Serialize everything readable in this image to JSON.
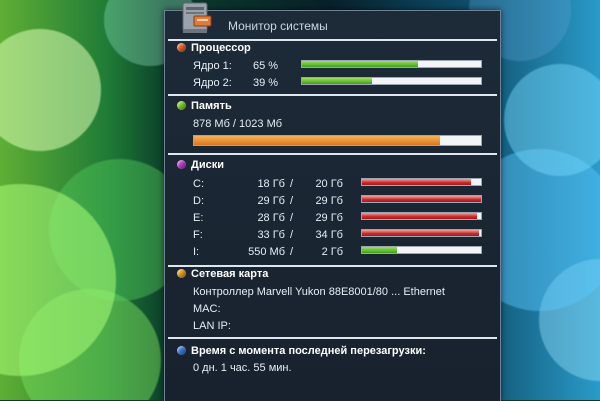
{
  "app": {
    "title": "Монитор системы",
    "icon": "computer-icon"
  },
  "cpu": {
    "title": "Процессор",
    "bullet_color": "#e8642a",
    "cores": [
      {
        "label": "Ядро 1:",
        "value_text": "65 %",
        "fraction": 0.65
      },
      {
        "label": "Ядро 2:",
        "value_text": "39 %",
        "fraction": 0.39
      }
    ]
  },
  "memory": {
    "title": "Память",
    "bullet_color": "#7fd22a",
    "usage_text": "878 Мб / 1023 Мб",
    "fraction": 0.858
  },
  "disks": {
    "title": "Диски",
    "bullet_color": "#c23fd0",
    "items": [
      {
        "drive": "C:",
        "used": "18 Гб",
        "sep": "/",
        "total": "20 Гб",
        "fraction": 0.92,
        "color": "red"
      },
      {
        "drive": "D:",
        "used": "29 Гб",
        "sep": "/",
        "total": "29 Гб",
        "fraction": 1.0,
        "color": "red"
      },
      {
        "drive": "E:",
        "used": "28 Гб",
        "sep": "/",
        "total": "29 Гб",
        "fraction": 0.97,
        "color": "red"
      },
      {
        "drive": "F:",
        "used": "33 Гб",
        "sep": "/",
        "total": "34 Гб",
        "fraction": 0.98,
        "color": "red"
      },
      {
        "drive": "I:",
        "used": "550 Мб",
        "sep": "/",
        "total": "2 Гб",
        "fraction": 0.29,
        "color": "green"
      }
    ]
  },
  "network": {
    "title": "Сетевая карта",
    "bullet_color": "#f0a020",
    "adapter": "Контроллер Marvell Yukon 88E8001/80 ... Ethernet",
    "mac_label": "MAC:",
    "ip_label": "LAN IP:"
  },
  "uptime": {
    "title": "Время с момента последней перезагрузки:",
    "bullet_color": "#3f7ee0",
    "value": "0 дн. 1 час. 55 мин."
  }
}
